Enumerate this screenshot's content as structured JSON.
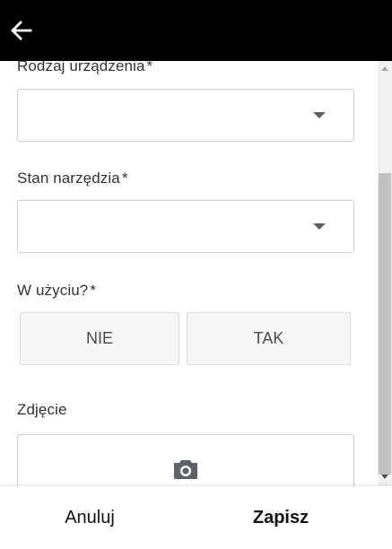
{
  "header": {
    "back_icon": "arrow-left-icon",
    "background": "#000000"
  },
  "form": {
    "device_type": {
      "label": "Rodzaj urządzenia",
      "required_mark": "*",
      "value": ""
    },
    "tool_condition": {
      "label": "Stan narzędzia",
      "required_mark": "*",
      "value": ""
    },
    "in_use": {
      "label": "W użyciu?",
      "required_mark": "*",
      "options": [
        "NIE",
        "TAK"
      ]
    },
    "photo": {
      "label": "Zdjęcie",
      "icon": "camera-icon"
    }
  },
  "footer": {
    "cancel_label": "Anuluj",
    "save_label": "Zapisz"
  }
}
